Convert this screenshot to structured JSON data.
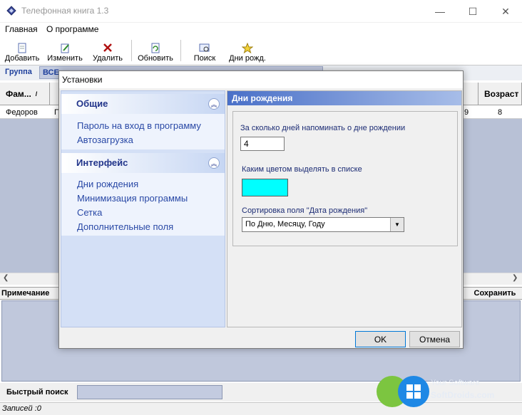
{
  "window": {
    "title": "Телефонная  книга 1.3",
    "controls": [
      "—",
      "☐",
      "✕"
    ]
  },
  "menu": [
    "Главная",
    "О программе"
  ],
  "toolbar": {
    "add": "Добавить",
    "edit": "Изменить",
    "delete": "Удалить",
    "refresh": "Обновить",
    "search": "Поиск",
    "birthdays": "Дни рожд."
  },
  "group": {
    "label": "Группа",
    "value": "ВСЕ"
  },
  "grid": {
    "headers": [
      "Фам...",
      "Возраст"
    ],
    "row": {
      "surname": "Федоров",
      "second": "П",
      "num": "9",
      "age": "8"
    }
  },
  "notes": {
    "label": "Примечание",
    "save": "Сохранить"
  },
  "quick_search": {
    "label": "Быстрый поиск"
  },
  "status": {
    "records": "Записей :0"
  },
  "dialog": {
    "title": "Установки",
    "nav": {
      "general": {
        "title": "Общие",
        "items": [
          "Пароль на вход в программу",
          "Автозагрузка"
        ]
      },
      "interface": {
        "title": "Интерфейс",
        "items": [
          "Дни рождения",
          "Минимизация программы",
          "Сетка",
          "Дополнительные поля"
        ]
      }
    },
    "panel": {
      "header": "Дни рождения",
      "days_label": "За сколько дней напоминать о дне рождении",
      "days_value": "4",
      "color_label": "Каким цветом выделять в списке",
      "color_value": "#00ffff",
      "sort_label": "Сортировка поля \"Дата рождения\"",
      "sort_value": "По Дню, Месяцу, Году"
    },
    "ok": "OK",
    "cancel": "Отмена"
  },
  "watermark": {
    "line1": "Your Software",
    "line2": "SoftDroids.com"
  }
}
